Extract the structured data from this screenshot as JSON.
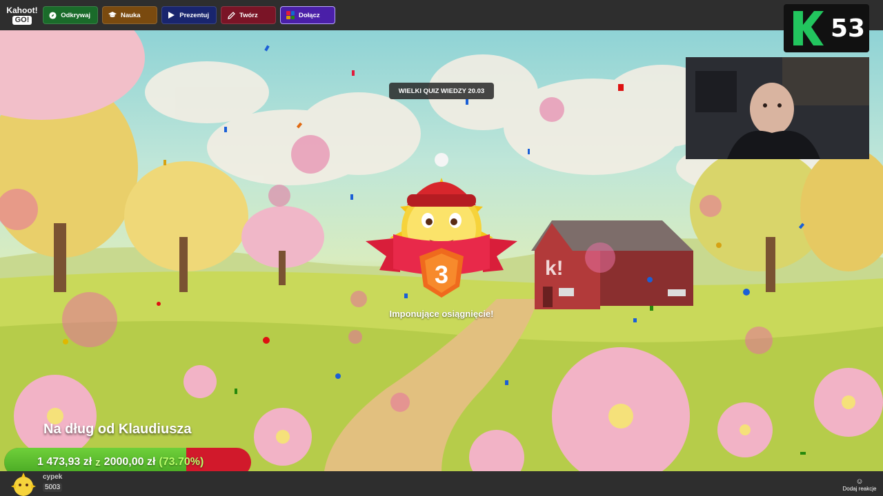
{
  "app": {
    "logo_line1": "Kahoot!",
    "logo_line2": "GO!"
  },
  "nav": {
    "items": [
      {
        "label": "Odkrywaj",
        "icon": "compass-icon",
        "color": "#1a6b2a"
      },
      {
        "label": "Nauka",
        "icon": "graduation-cap-icon",
        "color": "#7a4a0f"
      },
      {
        "label": "Prezentuj",
        "icon": "play-icon",
        "color": "#19256e"
      },
      {
        "label": "Twórz",
        "icon": "pencil-icon",
        "color": "#7a1426"
      },
      {
        "label": "Dołącz",
        "icon": "join-grid-icon",
        "color": "#4a1fa8"
      }
    ]
  },
  "quiz": {
    "title": "WIELKI QUIZ WIEDZY 20.03"
  },
  "achievement": {
    "rank": "3",
    "text": "Imponujące osiągnięcie!"
  },
  "score": {
    "value": "53"
  },
  "donation": {
    "title": "Na dług od Klaudiusza",
    "current": "1 473,93 zł",
    "separator": "z",
    "goal": "2000,00 zł",
    "percent_label": "(73.70%)",
    "progress_fraction": 0.737
  },
  "player": {
    "name": "cypek",
    "score": "5003"
  },
  "reaction": {
    "label": "Dodaj reakcje"
  },
  "colors": {
    "accent_green": "#46a522",
    "accent_red": "#d1192b",
    "score_green": "#22c55e"
  }
}
